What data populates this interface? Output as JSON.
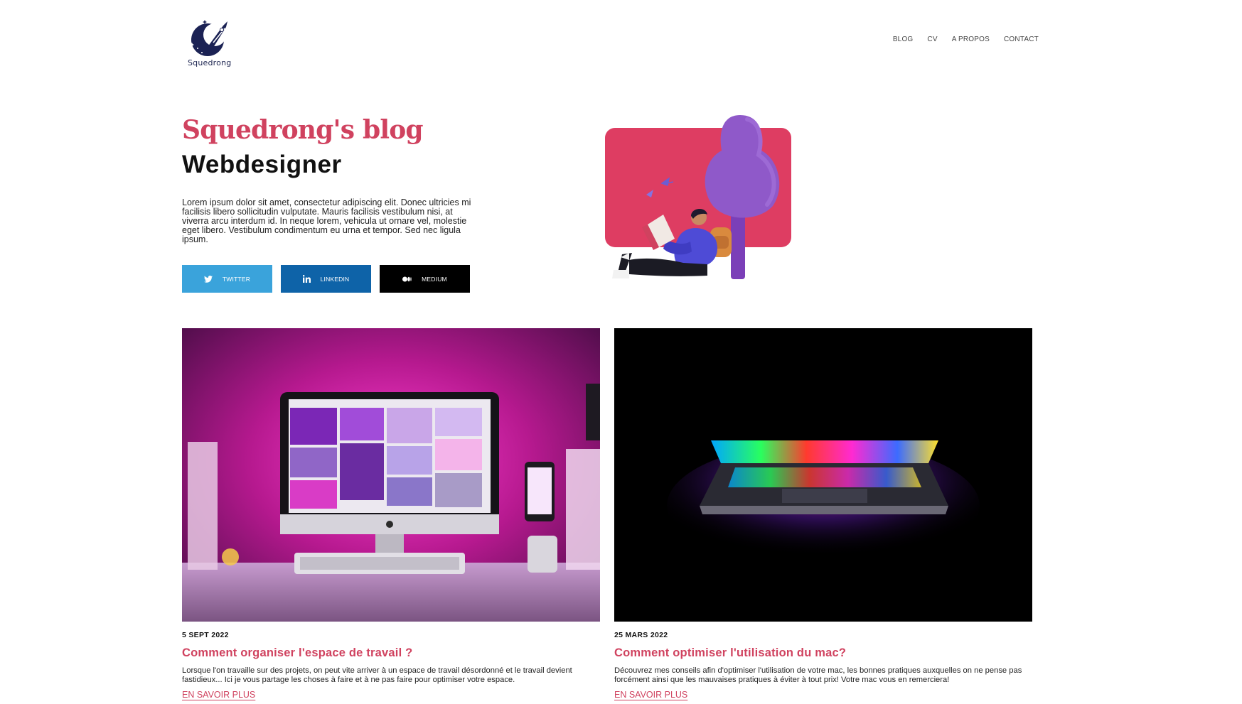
{
  "brand": {
    "name": "Squedrong"
  },
  "nav": {
    "items": [
      "BLOG",
      "CV",
      "A PROPOS",
      "CONTACT"
    ]
  },
  "hero": {
    "title": "Squedrong's blog",
    "subtitle": "Webdesigner",
    "description": "Lorem ipsum dolor sit amet, consectetur adipiscing elit. Donec ultricies mi facilisis libero sollicitudin vulputate. Mauris facilisis vestibulum nisi, at viverra arcu interdum id. In neque lorem, vehicula ut ornare vel, molestie eget libero. Vestibulum condimentum eu urna et tempor. Sed nec ligula ipsum."
  },
  "socials": [
    {
      "label": "TWITTER",
      "icon": "twitter-icon",
      "color": "#3aa3db"
    },
    {
      "label": "LINKEDIN",
      "icon": "linkedin-icon",
      "color": "#0e63a8"
    },
    {
      "label": "MEDIUM",
      "icon": "medium-icon",
      "color": "#000000"
    }
  ],
  "articles": [
    {
      "date": "5 SEPT 2022",
      "title": "Comment organiser l'espace de travail ?",
      "excerpt": "Lorsque l'on travaille sur des projets, on peut vite arriver à un espace de travail désordonné et le travail devient fastidieux... Ici je vous partage les choses à faire et à ne pas faire pour optimiser votre espace.",
      "more": "EN SAVOIR PLUS"
    },
    {
      "date": "25 MARS 2022",
      "title": "Comment optimiser l'utilisation du mac?",
      "excerpt": "Découvrez mes conseils afin d'optimiser l'utilisation de votre mac, les bonnes pratiques auxquelles on ne pense pas forcément ainsi que les mauvaises pratiques à éviter à tout prix! Votre mac vous en remerciera!",
      "more": "EN SAVOIR PLUS"
    }
  ],
  "colors": {
    "accent": "#d0425f",
    "twitter": "#3aa3db",
    "linkedin": "#0e63a8",
    "medium": "#000000"
  }
}
